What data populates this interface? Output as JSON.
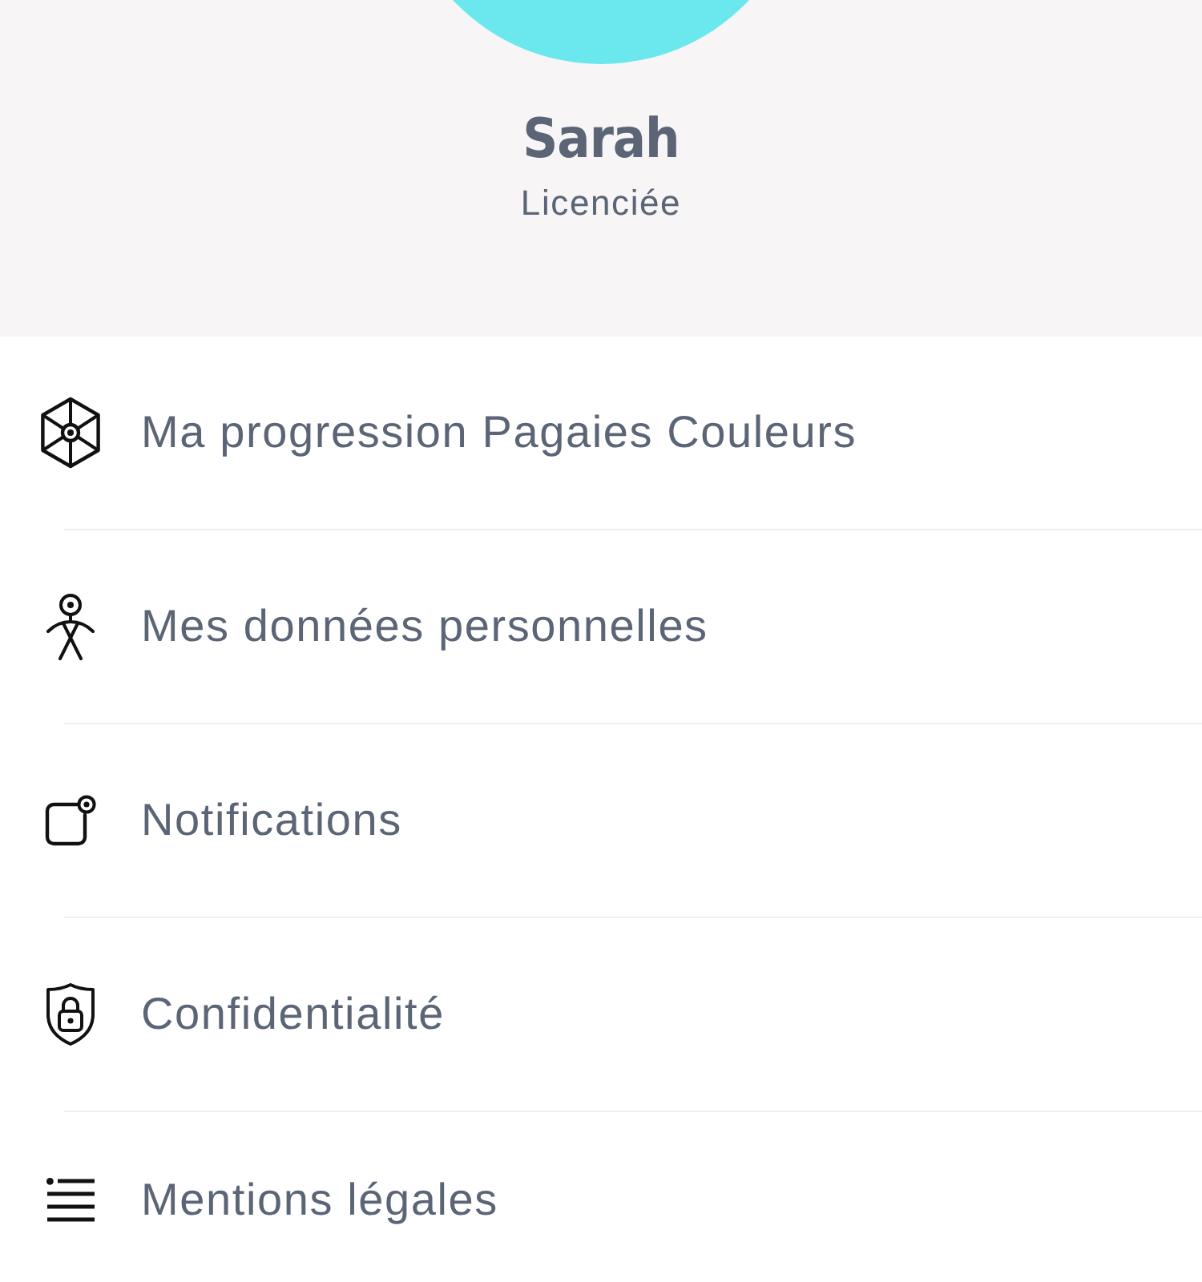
{
  "profile": {
    "name": "Sarah",
    "status": "Licenciée"
  },
  "menu": {
    "items": [
      {
        "kind": "hexagon",
        "label": "Ma progression Pagaies Couleurs"
      },
      {
        "kind": "person",
        "label": "Mes données personnelles"
      },
      {
        "kind": "notice",
        "label": "Notifications"
      },
      {
        "kind": "shield",
        "label": "Confidentialité"
      },
      {
        "kind": "list",
        "label": "Mentions légales"
      }
    ]
  }
}
